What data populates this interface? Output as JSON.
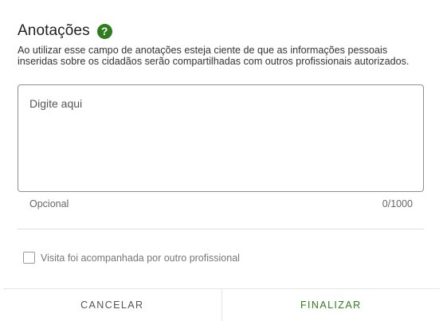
{
  "annotations": {
    "title": "Anotações",
    "help_icon": "question-circle-icon",
    "notice": "Ao utilizar esse campo de anotações esteja ciente de que as informações pessoais inseridas sobre os cidadãos serão compartilhadas com outros profissionais autorizados.",
    "field": {
      "placeholder": "Digite aqui",
      "value": "",
      "helper": "Opcional",
      "counter": "0/1000"
    },
    "checkbox": {
      "label": "Visita foi acompanhada por outro profissional",
      "checked": false
    }
  },
  "footer": {
    "cancel_label": "CANCELAR",
    "finish_label": "FINALIZAR"
  },
  "colors": {
    "accent": "#2d7d1c",
    "border": "#8e8e8e",
    "divider": "#dedede"
  }
}
